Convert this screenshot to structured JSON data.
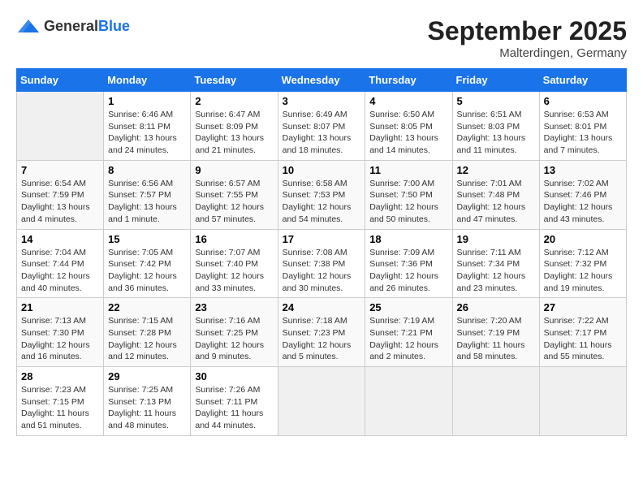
{
  "header": {
    "logo_general": "General",
    "logo_blue": "Blue",
    "month": "September 2025",
    "location": "Malterdingen, Germany"
  },
  "weekdays": [
    "Sunday",
    "Monday",
    "Tuesday",
    "Wednesday",
    "Thursday",
    "Friday",
    "Saturday"
  ],
  "weeks": [
    [
      {
        "day": "",
        "empty": true
      },
      {
        "day": "1",
        "sunrise": "Sunrise: 6:46 AM",
        "sunset": "Sunset: 8:11 PM",
        "daylight": "Daylight: 13 hours and 24 minutes."
      },
      {
        "day": "2",
        "sunrise": "Sunrise: 6:47 AM",
        "sunset": "Sunset: 8:09 PM",
        "daylight": "Daylight: 13 hours and 21 minutes."
      },
      {
        "day": "3",
        "sunrise": "Sunrise: 6:49 AM",
        "sunset": "Sunset: 8:07 PM",
        "daylight": "Daylight: 13 hours and 18 minutes."
      },
      {
        "day": "4",
        "sunrise": "Sunrise: 6:50 AM",
        "sunset": "Sunset: 8:05 PM",
        "daylight": "Daylight: 13 hours and 14 minutes."
      },
      {
        "day": "5",
        "sunrise": "Sunrise: 6:51 AM",
        "sunset": "Sunset: 8:03 PM",
        "daylight": "Daylight: 13 hours and 11 minutes."
      },
      {
        "day": "6",
        "sunrise": "Sunrise: 6:53 AM",
        "sunset": "Sunset: 8:01 PM",
        "daylight": "Daylight: 13 hours and 7 minutes."
      }
    ],
    [
      {
        "day": "7",
        "sunrise": "Sunrise: 6:54 AM",
        "sunset": "Sunset: 7:59 PM",
        "daylight": "Daylight: 13 hours and 4 minutes."
      },
      {
        "day": "8",
        "sunrise": "Sunrise: 6:56 AM",
        "sunset": "Sunset: 7:57 PM",
        "daylight": "Daylight: 13 hours and 1 minute."
      },
      {
        "day": "9",
        "sunrise": "Sunrise: 6:57 AM",
        "sunset": "Sunset: 7:55 PM",
        "daylight": "Daylight: 12 hours and 57 minutes."
      },
      {
        "day": "10",
        "sunrise": "Sunrise: 6:58 AM",
        "sunset": "Sunset: 7:53 PM",
        "daylight": "Daylight: 12 hours and 54 minutes."
      },
      {
        "day": "11",
        "sunrise": "Sunrise: 7:00 AM",
        "sunset": "Sunset: 7:50 PM",
        "daylight": "Daylight: 12 hours and 50 minutes."
      },
      {
        "day": "12",
        "sunrise": "Sunrise: 7:01 AM",
        "sunset": "Sunset: 7:48 PM",
        "daylight": "Daylight: 12 hours and 47 minutes."
      },
      {
        "day": "13",
        "sunrise": "Sunrise: 7:02 AM",
        "sunset": "Sunset: 7:46 PM",
        "daylight": "Daylight: 12 hours and 43 minutes."
      }
    ],
    [
      {
        "day": "14",
        "sunrise": "Sunrise: 7:04 AM",
        "sunset": "Sunset: 7:44 PM",
        "daylight": "Daylight: 12 hours and 40 minutes."
      },
      {
        "day": "15",
        "sunrise": "Sunrise: 7:05 AM",
        "sunset": "Sunset: 7:42 PM",
        "daylight": "Daylight: 12 hours and 36 minutes."
      },
      {
        "day": "16",
        "sunrise": "Sunrise: 7:07 AM",
        "sunset": "Sunset: 7:40 PM",
        "daylight": "Daylight: 12 hours and 33 minutes."
      },
      {
        "day": "17",
        "sunrise": "Sunrise: 7:08 AM",
        "sunset": "Sunset: 7:38 PM",
        "daylight": "Daylight: 12 hours and 30 minutes."
      },
      {
        "day": "18",
        "sunrise": "Sunrise: 7:09 AM",
        "sunset": "Sunset: 7:36 PM",
        "daylight": "Daylight: 12 hours and 26 minutes."
      },
      {
        "day": "19",
        "sunrise": "Sunrise: 7:11 AM",
        "sunset": "Sunset: 7:34 PM",
        "daylight": "Daylight: 12 hours and 23 minutes."
      },
      {
        "day": "20",
        "sunrise": "Sunrise: 7:12 AM",
        "sunset": "Sunset: 7:32 PM",
        "daylight": "Daylight: 12 hours and 19 minutes."
      }
    ],
    [
      {
        "day": "21",
        "sunrise": "Sunrise: 7:13 AM",
        "sunset": "Sunset: 7:30 PM",
        "daylight": "Daylight: 12 hours and 16 minutes."
      },
      {
        "day": "22",
        "sunrise": "Sunrise: 7:15 AM",
        "sunset": "Sunset: 7:28 PM",
        "daylight": "Daylight: 12 hours and 12 minutes."
      },
      {
        "day": "23",
        "sunrise": "Sunrise: 7:16 AM",
        "sunset": "Sunset: 7:25 PM",
        "daylight": "Daylight: 12 hours and 9 minutes."
      },
      {
        "day": "24",
        "sunrise": "Sunrise: 7:18 AM",
        "sunset": "Sunset: 7:23 PM",
        "daylight": "Daylight: 12 hours and 5 minutes."
      },
      {
        "day": "25",
        "sunrise": "Sunrise: 7:19 AM",
        "sunset": "Sunset: 7:21 PM",
        "daylight": "Daylight: 12 hours and 2 minutes."
      },
      {
        "day": "26",
        "sunrise": "Sunrise: 7:20 AM",
        "sunset": "Sunset: 7:19 PM",
        "daylight": "Daylight: 11 hours and 58 minutes."
      },
      {
        "day": "27",
        "sunrise": "Sunrise: 7:22 AM",
        "sunset": "Sunset: 7:17 PM",
        "daylight": "Daylight: 11 hours and 55 minutes."
      }
    ],
    [
      {
        "day": "28",
        "sunrise": "Sunrise: 7:23 AM",
        "sunset": "Sunset: 7:15 PM",
        "daylight": "Daylight: 11 hours and 51 minutes."
      },
      {
        "day": "29",
        "sunrise": "Sunrise: 7:25 AM",
        "sunset": "Sunset: 7:13 PM",
        "daylight": "Daylight: 11 hours and 48 minutes."
      },
      {
        "day": "30",
        "sunrise": "Sunrise: 7:26 AM",
        "sunset": "Sunset: 7:11 PM",
        "daylight": "Daylight: 11 hours and 44 minutes."
      },
      {
        "day": "",
        "empty": true
      },
      {
        "day": "",
        "empty": true
      },
      {
        "day": "",
        "empty": true
      },
      {
        "day": "",
        "empty": true
      }
    ]
  ]
}
